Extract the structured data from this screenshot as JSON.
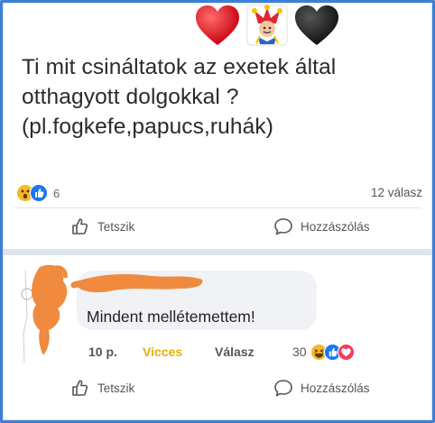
{
  "post": {
    "lines": [
      "Ti mit csináltatok az exetek által",
      "otthagyott dolgokkal ?",
      "(pl.fogkefe,papucs,ruhák)"
    ],
    "reaction_count": "6",
    "replies": "12 válasz",
    "like_label": "Tetszik",
    "comment_label": "Hozzászólás"
  },
  "comment": {
    "text": "Mindent mellétemettem!",
    "time": "10 p.",
    "reaction_label": "Vicces",
    "reply_label": "Válasz",
    "reaction_count": "30",
    "like_label": "Tetszik",
    "comment_label": "Hozzászólás"
  },
  "colors": {
    "frame": "#3b7fd6",
    "like_blue": "#1877f2",
    "love_red": "#f33e58",
    "haha_yellow": "#f7b928",
    "vicces": "#e6b000",
    "scribble": "#f08a3e"
  },
  "icons": [
    "red-heart-icon",
    "jester-icon",
    "black-heart-icon",
    "like-thumb-icon",
    "comment-bubble-icon",
    "haha-reaction-icon",
    "like-reaction-icon",
    "love-reaction-icon",
    "wow-reaction-icon"
  ]
}
